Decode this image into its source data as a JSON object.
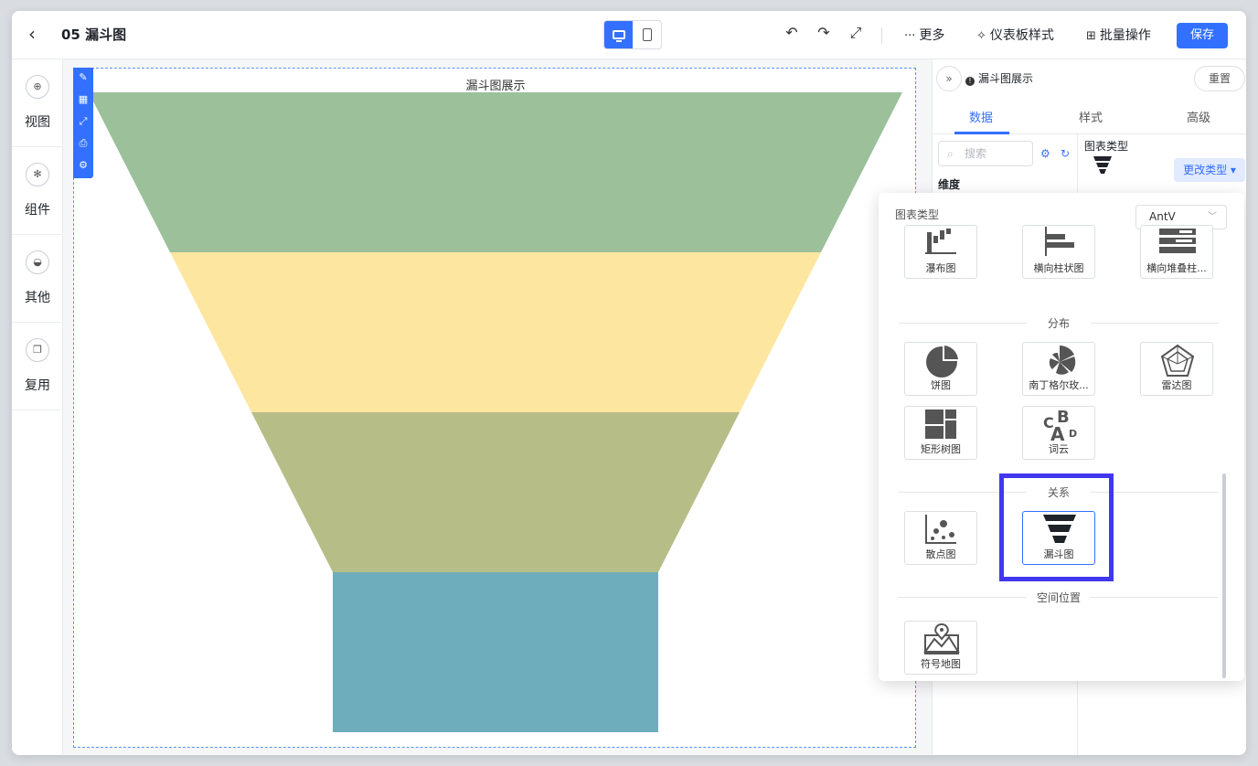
{
  "header": {
    "title": "05 漏斗图",
    "actions": {
      "more": "更多",
      "dashboard_style": "仪表板样式",
      "batch": "批量操作"
    },
    "save_label": "保存"
  },
  "sidebar": {
    "items": [
      {
        "label": "视图",
        "icon": "plus-circle-icon"
      },
      {
        "label": "组件",
        "icon": "gear-icon"
      },
      {
        "label": "其他",
        "icon": "cup-icon"
      },
      {
        "label": "复用",
        "icon": "copy-icon"
      }
    ]
  },
  "canvas": {
    "chart_title": "漏斗图展示"
  },
  "chart_data": {
    "type": "funnel",
    "title": "漏斗图展示",
    "stages": [
      {
        "value": 100,
        "color": "#9bc09a"
      },
      {
        "value": 80,
        "color": "#fde6a0"
      },
      {
        "value": 60,
        "color": "#b7bd86"
      },
      {
        "value": 40,
        "color": "#6eadbb"
      }
    ]
  },
  "panel": {
    "chart_name": "漏斗图展示",
    "reset_label": "重置",
    "tabs": [
      "数据",
      "样式",
      "高级"
    ],
    "search_placeholder": "搜索",
    "dimension_label": "维度",
    "chart_type_label": "图表类型",
    "change_type_label": "更改类型 ▾"
  },
  "popup": {
    "title": "图表类型",
    "library": "AntV",
    "top_row": [
      "瀑布图",
      "横向柱状图",
      "横向堆叠柱..."
    ],
    "sections": {
      "distribution": {
        "title": "分布",
        "items": [
          "饼图",
          "南丁格尔玫...",
          "雷达图",
          "矩形树图",
          "词云"
        ]
      },
      "relation": {
        "title": "关系",
        "items": [
          "散点图",
          "漏斗图"
        ]
      },
      "spatial": {
        "title": "空间位置",
        "items": [
          "符号地图"
        ]
      }
    }
  }
}
